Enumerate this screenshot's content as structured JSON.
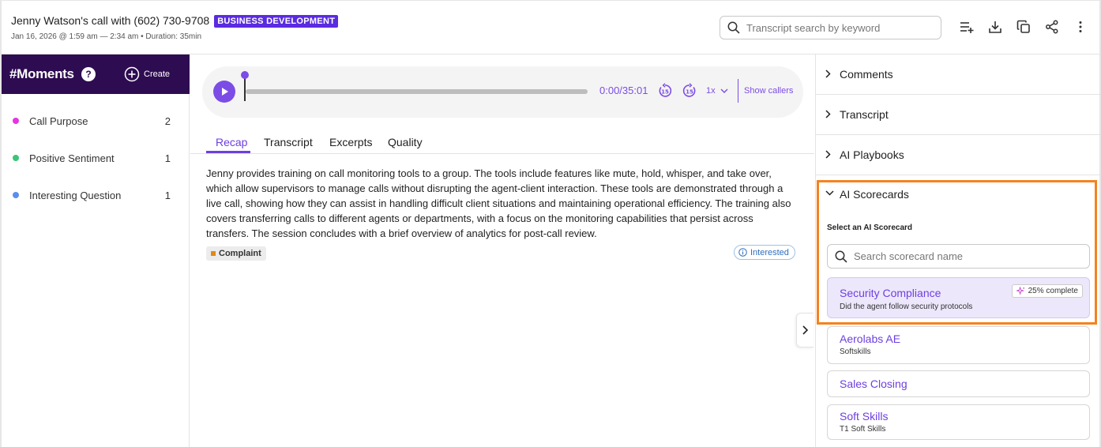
{
  "header": {
    "title": "Jenny Watson's call with (602) 730-9708",
    "badge": "BUSINESS DEVELOPMENT",
    "meta": "Jan 16, 2026 @ 1:59 am — 2:34 am • Duration: 35min",
    "search_placeholder": "Transcript search by keyword",
    "icons": [
      "add-to-list-icon",
      "download-icon",
      "copy-icon",
      "share-icon",
      "more-vertical-icon"
    ]
  },
  "moments": {
    "title": "#Moments",
    "help": "?",
    "create_label": "Create",
    "items": [
      {
        "label": "Call Purpose",
        "count": "2",
        "color": "#e535e0"
      },
      {
        "label": "Positive Sentiment",
        "count": "1",
        "color": "#3cc47a"
      },
      {
        "label": "Interesting Question",
        "count": "1",
        "color": "#5b8def"
      }
    ]
  },
  "player": {
    "time": "0:00/35:01",
    "speed": "1x",
    "show_callers": "Show callers",
    "progress_fraction": 0
  },
  "tabs": [
    "Recap",
    "Transcript",
    "Excerpts",
    "Quality"
  ],
  "active_tab": "Recap",
  "recap": {
    "text": "Jenny provides training on call monitoring tools to a group. The tools include features like mute, hold, whisper, and take over, which allow supervisors to manage calls without disrupting the agent-client interaction. These tools are demonstrated through a live call, showing how they can assist in handling difficult client situations and maintaining operational efficiency. The training also covers transferring calls to different agents or departments, with a focus on the monitoring capabilities that persist across transfers. The session concludes with a brief overview of analytics for post-call review.",
    "tag": "Complaint",
    "sentiment": "Interested"
  },
  "right_panel": {
    "sections": [
      "Comments",
      "Transcript",
      "AI Playbooks",
      "AI Scorecards"
    ],
    "select_label": "Select an AI Scorecard",
    "search_placeholder": "Search scorecard name",
    "scorecards": [
      {
        "name": "Security Compliance",
        "description": "Did the agent follow security protocols",
        "progress": "25% complete"
      },
      {
        "name": "Aerolabs AE",
        "description": "Softskills"
      },
      {
        "name": "Sales Closing",
        "description": ""
      },
      {
        "name": "Soft Skills",
        "description": "T1 Soft Skills"
      }
    ]
  },
  "colors": {
    "accent": "#6c3fe0",
    "moments_header": "#2e0c51",
    "highlight_border": "#f58220"
  }
}
